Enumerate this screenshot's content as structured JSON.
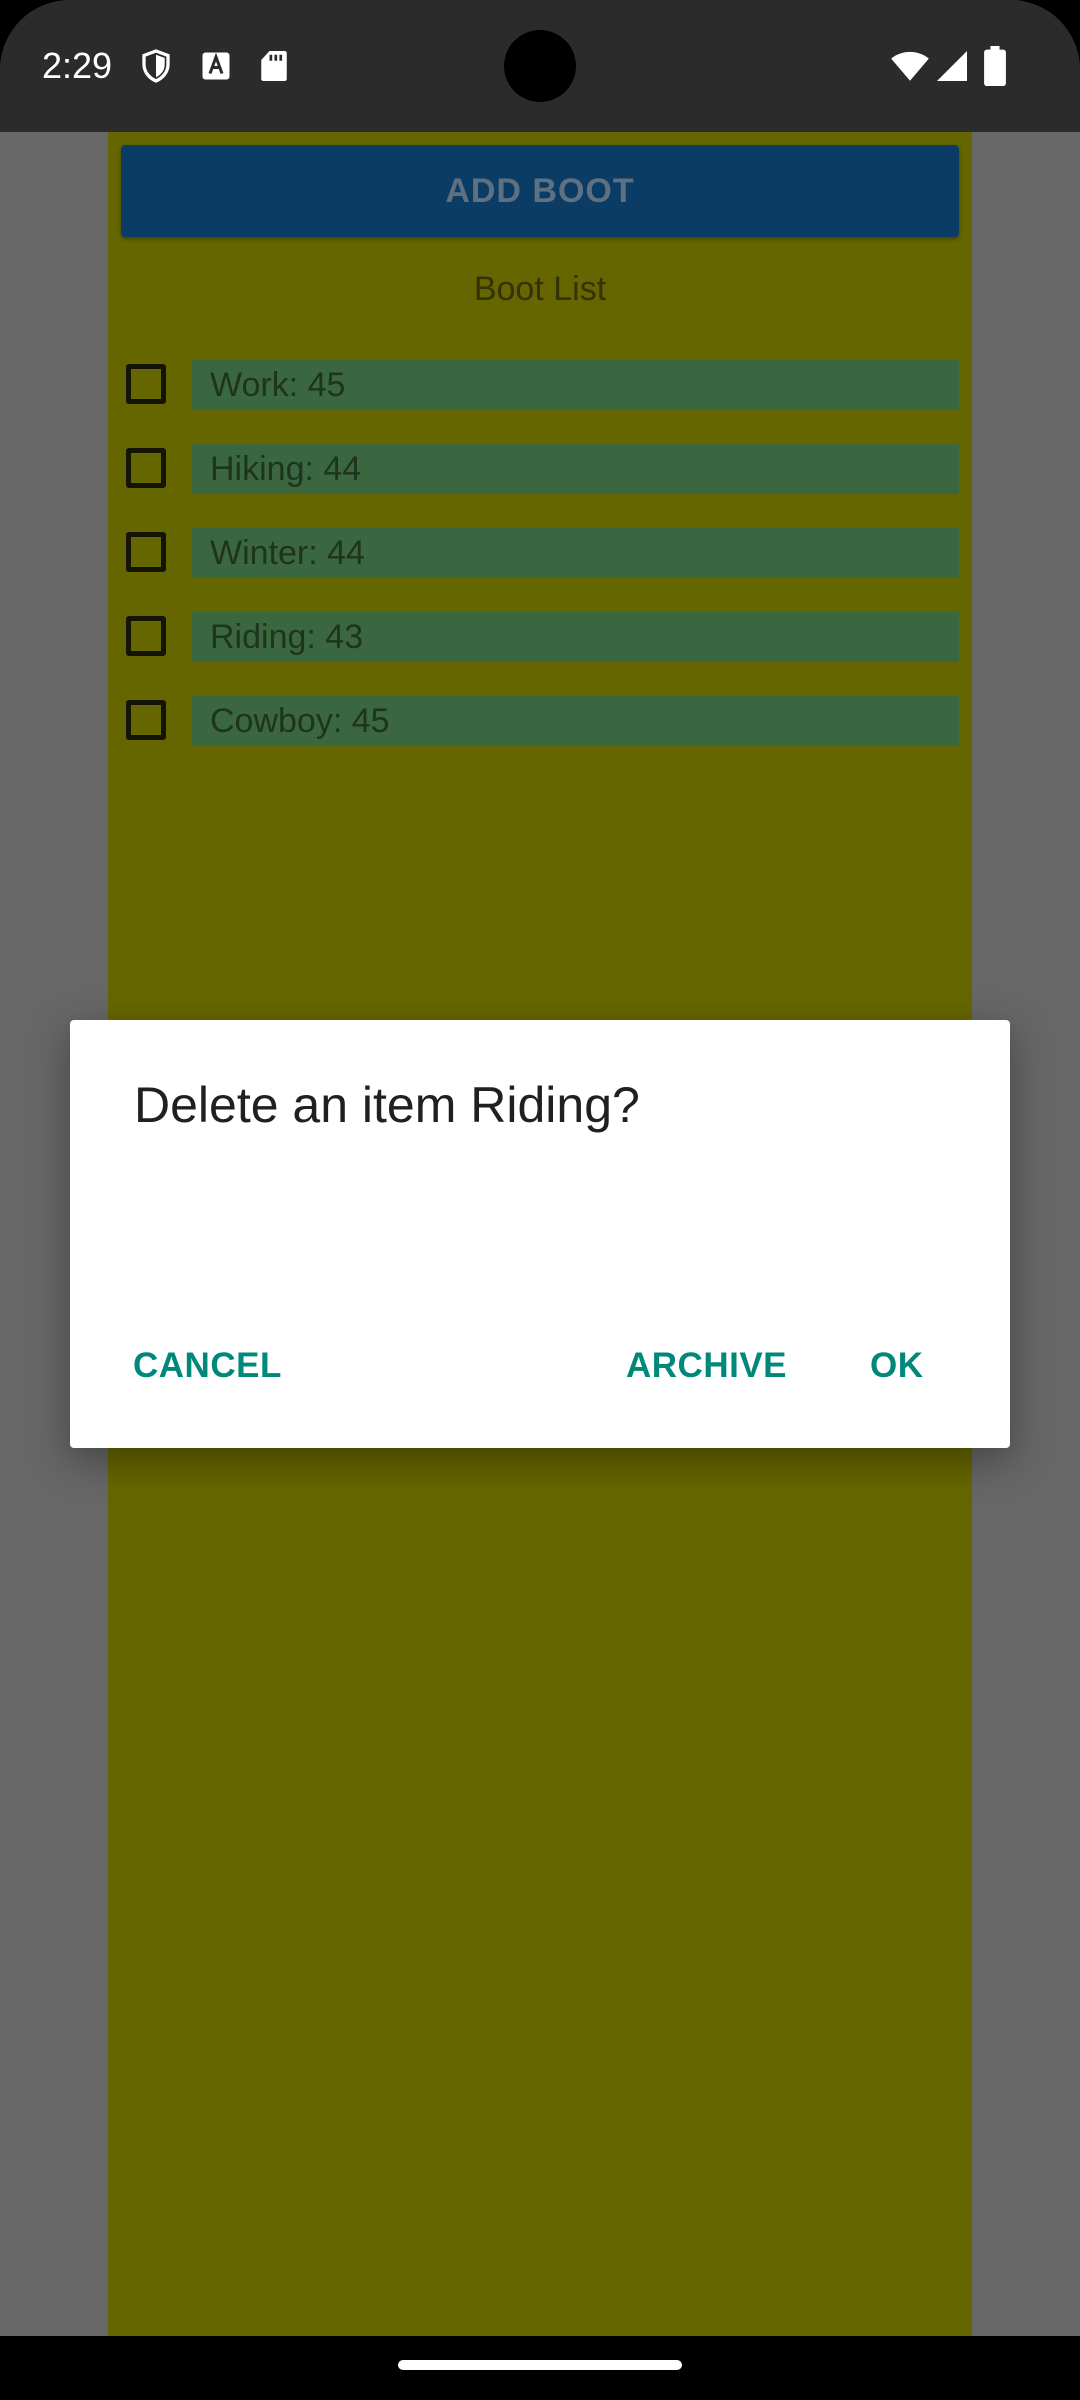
{
  "status_bar": {
    "time": "2:29",
    "icons": [
      "shield-icon",
      "a-icon",
      "sd-card-icon",
      "wifi-icon",
      "signal-icon",
      "battery-icon"
    ]
  },
  "app": {
    "add_button_label": "ADD BOOT",
    "list_title": "Boot List",
    "items": [
      {
        "label": "Work: 45",
        "checked": false
      },
      {
        "label": "Hiking: 44",
        "checked": false
      },
      {
        "label": "Winter: 44",
        "checked": false
      },
      {
        "label": "Riding: 43",
        "checked": false
      },
      {
        "label": "Cowboy: 45",
        "checked": false
      }
    ]
  },
  "dialog": {
    "title": "Delete an item Riding?",
    "cancel_label": "CANCEL",
    "archive_label": "ARCHIVE",
    "ok_label": "OK"
  },
  "colors": {
    "app_background": "#666600",
    "button": "#0a3c66",
    "item_background": "#3b6740",
    "dialog_accent": "#00897b"
  }
}
